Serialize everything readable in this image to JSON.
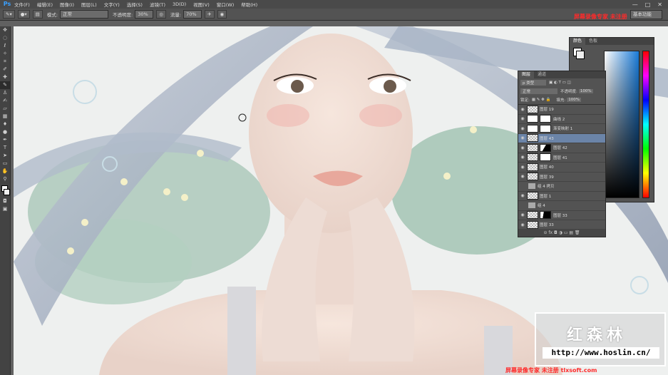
{
  "menubar": {
    "app_logo": "Ps",
    "items": [
      "文件(F)",
      "编辑(E)",
      "图像(I)",
      "图层(L)",
      "文字(Y)",
      "选择(S)",
      "滤镜(T)",
      "3D(D)",
      "视图(V)",
      "窗口(W)",
      "帮助(H)"
    ],
    "window_controls": [
      "—",
      "□",
      "✕"
    ]
  },
  "options": {
    "mode_label": "模式:",
    "mode_value": "正常",
    "opacity_label": "不透明度:",
    "opacity_value": "30%",
    "flow_label": "流量:",
    "flow_value": "70%",
    "workspace": "基本功能"
  },
  "overlay": {
    "recording_top": "屏幕录像专家  未注册",
    "recording_bottom": "屏幕录像专家  未注册  tlxsoft.com",
    "brand_name": "红森林",
    "brand_url": "http://www.hoslin.cn/"
  },
  "color_panel": {
    "tabs": [
      "颜色",
      "色板"
    ],
    "accent": "#ffffff"
  },
  "layers_panel": {
    "tabs": [
      "图层",
      "通道"
    ],
    "kind_filter": "p 类型",
    "blend_mode": "正常",
    "opacity_label": "不透明度:",
    "opacity_value": "100%",
    "lock_label": "锁定:",
    "fill_label": "填充:",
    "fill_value": "100%",
    "layers": [
      {
        "name": "图层 19",
        "type": "pixel",
        "selected": false
      },
      {
        "name": "曲线 2",
        "type": "adjust",
        "selected": false
      },
      {
        "name": "渐变映射 1",
        "type": "adjust",
        "selected": false
      },
      {
        "name": "图层 43",
        "type": "pixel",
        "selected": true
      },
      {
        "name": "图层 42",
        "type": "masked",
        "selected": false
      },
      {
        "name": "图层 41",
        "type": "masked",
        "selected": false
      },
      {
        "name": "图层 40",
        "type": "pixel",
        "selected": false
      },
      {
        "name": "图层 39",
        "type": "pixel",
        "selected": false
      },
      {
        "name": "组 4 拷贝",
        "type": "group",
        "selected": false
      },
      {
        "name": "图层 1",
        "type": "pixel",
        "selected": false
      },
      {
        "name": "组 4",
        "type": "group",
        "selected": false
      },
      {
        "name": "图层 33",
        "type": "masked",
        "selected": false
      },
      {
        "name": "图层 33",
        "type": "pixel",
        "selected": false
      }
    ]
  },
  "tools": [
    "move",
    "marquee",
    "lasso",
    "quick-select",
    "crop",
    "eyedropper",
    "heal",
    "brush",
    "stamp",
    "history",
    "eraser",
    "gradient",
    "blur",
    "dodge",
    "pen",
    "type",
    "path-select",
    "shape",
    "hand",
    "zoom"
  ]
}
